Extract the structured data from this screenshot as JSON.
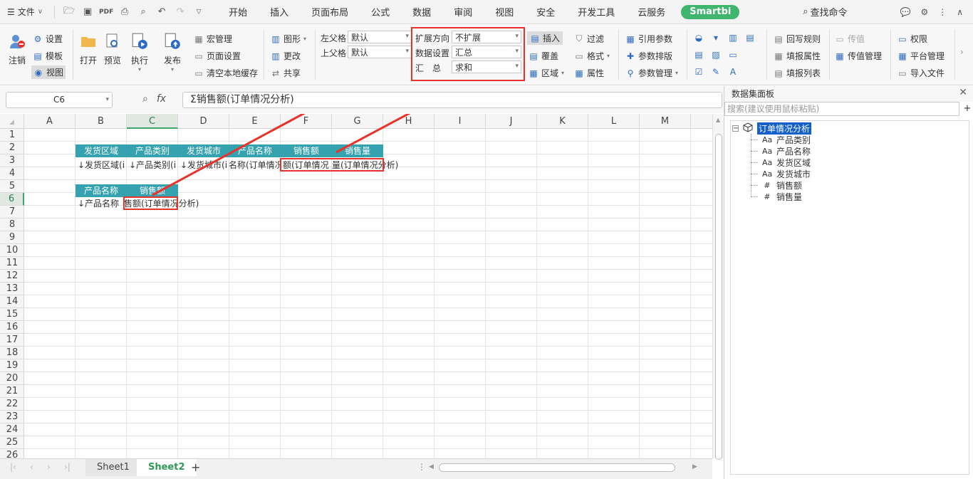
{
  "menubar": {
    "file_label": "文件",
    "tabs": [
      "开始",
      "插入",
      "页面布局",
      "公式",
      "数据",
      "审阅",
      "视图",
      "安全",
      "开发工具",
      "云服务"
    ],
    "smartbi": "Smartbi",
    "search_cmd": "查找命令"
  },
  "ribbon": {
    "logout": "注销",
    "settings": "设置",
    "template": "模板",
    "view": "视图",
    "open": "打开",
    "preview": "预览",
    "execute": "执行",
    "publish": "发布",
    "macro": "宏管理",
    "page_setup": "页面设置",
    "clear_cache": "清空本地缓存",
    "chart": "图形",
    "change": "更改",
    "share": "共享",
    "left_parent_label": "左父格",
    "left_parent_value": "默认",
    "top_parent_label": "上父格",
    "top_parent_value": "默认",
    "expand_dir_label": "扩展方向",
    "expand_dir_value": "不扩展",
    "data_setting_label": "数据设置",
    "data_setting_value": "汇总",
    "summary_label": "汇　总",
    "summary_value": "求和",
    "insert": "插入",
    "cover": "覆盖",
    "region": "区域",
    "filter": "过滤",
    "format": "格式",
    "attribute": "属性",
    "ref_param": "引用参数",
    "param_layout": "参数排版",
    "param_mgmt": "参数管理",
    "writeback": "回写规则",
    "fill_attr": "填报属性",
    "fill_list": "填报列表",
    "pass_value": "传值",
    "pass_value_mgmt": "传值管理",
    "permission": "权限",
    "platform_mgmt": "平台管理",
    "import_file": "导入文件"
  },
  "formula": {
    "cell_ref": "C6",
    "fx": "fx",
    "content": "Σ销售额(订单情况分析)"
  },
  "grid": {
    "columns": [
      "A",
      "B",
      "C",
      "D",
      "E",
      "F",
      "G",
      "H",
      "I",
      "J",
      "K",
      "L",
      "M"
    ],
    "rows": [
      "1",
      "2",
      "3",
      "4",
      "5",
      "6",
      "7",
      "8",
      "9",
      "10",
      "11",
      "12",
      "13",
      "14",
      "15",
      "16",
      "17",
      "18",
      "19",
      "20",
      "21",
      "22",
      "23",
      "24",
      "25",
      "26"
    ],
    "row2_headers": [
      "发货区域",
      "产品类别",
      "发货城市",
      "产品名称",
      "销售额",
      "销售量"
    ],
    "row3_cells": [
      "↓发货区域(订单情况分析)",
      "↓产品类别(订单情况分析)",
      "↓发货城市(订单情况分析)",
      "名称(订单情况分析)",
      "额(订单情况分析)",
      "量(订单情况分析)"
    ],
    "row3_display": [
      "↓发货区域(i",
      "↓产品类别(i",
      "↓发货城市(i",
      "名称(订单情况",
      "额(订单情况",
      "量(订单情况分析)"
    ],
    "row5_headers": [
      "产品名称",
      "销售额"
    ],
    "row6_cells": [
      "↓产品名称",
      "售额(订单情况分析)"
    ]
  },
  "sheets": {
    "tabs": [
      "Sheet1",
      "Sheet2"
    ],
    "active": "Sheet2",
    "add": "+"
  },
  "panel": {
    "title": "数据集面板",
    "search_placeholder": "搜索(建议使用鼠标粘贴)",
    "root": "订单情况分析",
    "fields": [
      {
        "type": "Aa",
        "name": "产品类别"
      },
      {
        "type": "Aa",
        "name": "产品名称"
      },
      {
        "type": "Aa",
        "name": "发货区域"
      },
      {
        "type": "Aa",
        "name": "发货城市"
      },
      {
        "type": "#",
        "name": "销售额"
      },
      {
        "type": "#",
        "name": "销售量"
      }
    ]
  },
  "colors": {
    "accent": "#3fb56e",
    "header_teal": "#35a2b0",
    "annotation_red": "#e8322a",
    "tree_select": "#1560c8"
  }
}
